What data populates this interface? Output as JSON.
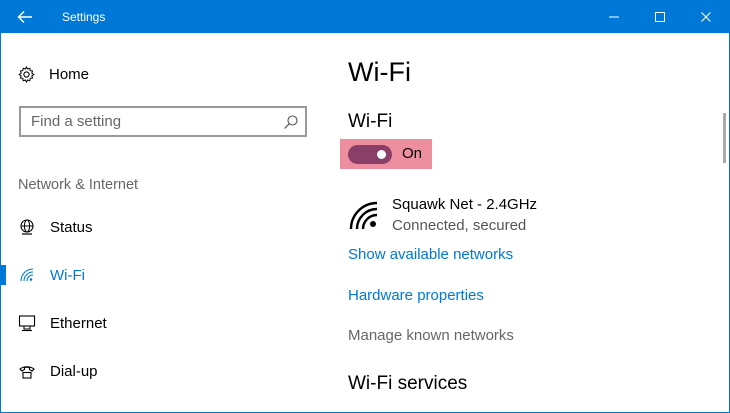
{
  "window": {
    "title": "Settings",
    "accent_color": "#0078d7"
  },
  "titlebar": {
    "back_icon": "back-arrow-icon",
    "minimize_icon": "minimize-icon",
    "maximize_icon": "maximize-icon",
    "close_icon": "close-icon"
  },
  "sidebar": {
    "home_label": "Home",
    "search": {
      "placeholder": "Find a setting"
    },
    "section_label": "Network & Internet",
    "items": [
      {
        "label": "Status",
        "icon": "globe-status-icon",
        "selected": false
      },
      {
        "label": "Wi-Fi",
        "icon": "wifi-icon",
        "selected": true
      },
      {
        "label": "Ethernet",
        "icon": "ethernet-icon",
        "selected": false
      },
      {
        "label": "Dial-up",
        "icon": "dialup-icon",
        "selected": false
      }
    ]
  },
  "main": {
    "page_title": "Wi-Fi",
    "wifi_toggle": {
      "heading": "Wi-Fi",
      "state_label": "On",
      "on": true,
      "track_color": "#8a3f69",
      "highlight_color": "#ee8fa0"
    },
    "network": {
      "name": "Squawk Net - 2.4GHz",
      "status": "Connected, secured",
      "icon": "wifi-signal-icon"
    },
    "links": {
      "show_networks": "Show available networks",
      "hardware_properties": "Hardware properties",
      "manage_networks": "Manage known networks"
    },
    "services_heading": "Wi-Fi services"
  }
}
